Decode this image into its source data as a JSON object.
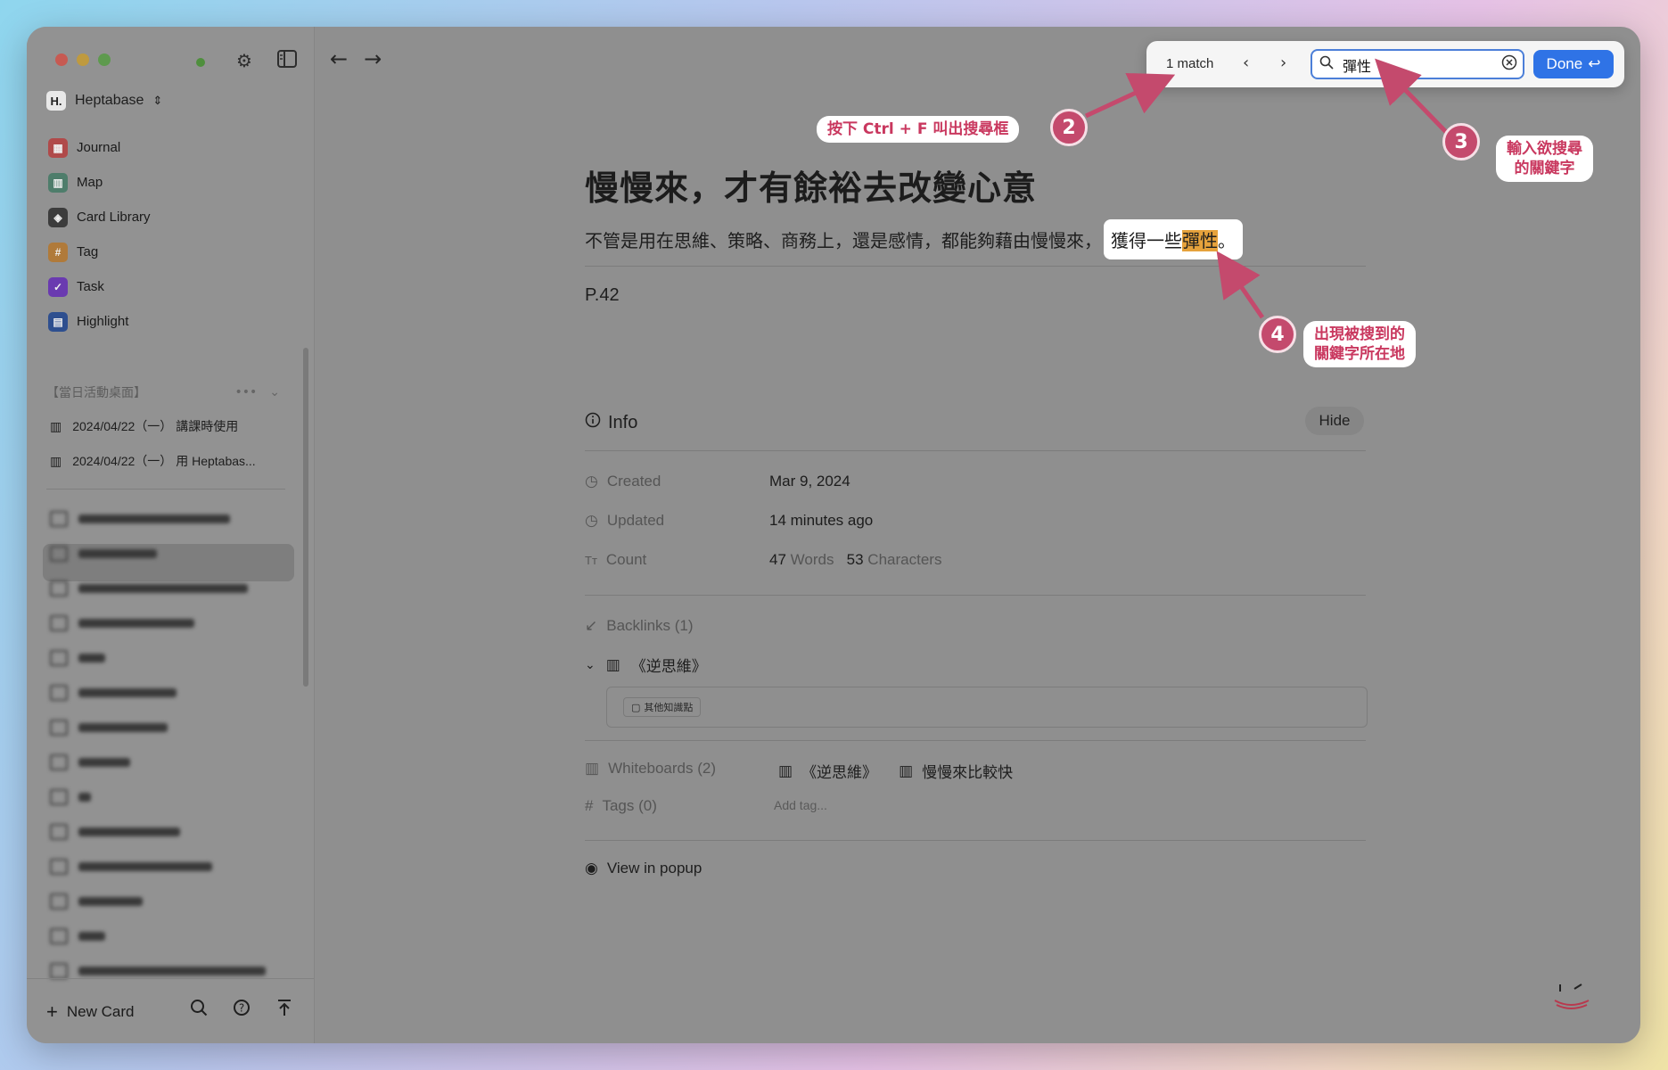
{
  "sidebar": {
    "workspace": "Heptabase",
    "items": [
      {
        "label": "Journal",
        "color": "#b04a4a"
      },
      {
        "label": "Map",
        "color": "#4e7d6b"
      },
      {
        "label": "Card Library",
        "color": "#3c3c3c"
      },
      {
        "label": "Tag",
        "color": "#b07a3a"
      },
      {
        "label": "Task",
        "color": "#6a3ab0"
      },
      {
        "label": "Highlight",
        "color": "#2e4f8f"
      }
    ],
    "section_title": "【當日活動桌面】",
    "whiteboards": [
      "2024/04/22（一） 講課時使用",
      "2024/04/22（一） 用 Heptabas..."
    ],
    "new_card": "New Card"
  },
  "findbar": {
    "match": "1 match",
    "query": "彈性",
    "done": "Done"
  },
  "card": {
    "title": "慢慢來，才有餘裕去改變心意",
    "para_before": "不管是用在思維、策略、商務上，還是感情，都能夠藉由慢慢來，",
    "para_box_before": "獲得一些",
    "para_highlight": "彈性",
    "para_box_after": "。",
    "page": "P.42"
  },
  "info": {
    "heading": "Info",
    "hide": "Hide",
    "created_label": "Created",
    "created_value": "Mar 9, 2024",
    "updated_label": "Updated",
    "updated_value": "14 minutes ago",
    "count_label": "Count",
    "words_num": "47",
    "words_label": "Words",
    "chars_num": "53",
    "chars_label": "Characters",
    "backlinks_label": "Backlinks (1)",
    "backlink_title": "《逆思維》",
    "backlink_chip": "其他知識點",
    "whiteboards_label": "Whiteboards (2)",
    "whiteboards": [
      "《逆思維》",
      "慢慢來比較快"
    ],
    "tags_label": "Tags (0)",
    "add_tag": "Add tag...",
    "view_popup": "View in popup"
  },
  "annotations": {
    "step2_num": "2",
    "step2_text": "按下 Ctrl + F 叫出搜尋框",
    "step3_num": "3",
    "step3_text_1": "輸入欲搜尋",
    "step3_text_2": "的關鍵字",
    "step4_num": "4",
    "step4_text_1": "出現被搜到的",
    "step4_text_2": "關鍵字所在地"
  }
}
